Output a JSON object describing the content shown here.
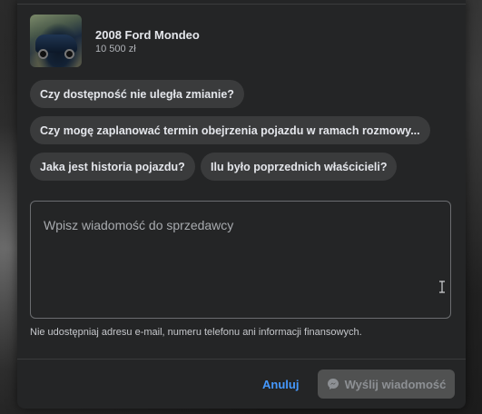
{
  "listing": {
    "title": "2008 Ford Mondeo",
    "price": "10 500 zł"
  },
  "suggestions": [
    "Czy dostępność nie uległa zmianie?",
    "Czy mogę zaplanować termin obejrzenia pojazdu w ramach rozmowy...",
    "Jaka jest historia pojazdu?",
    "Ilu było poprzednich właścicieli?"
  ],
  "message": {
    "placeholder": "Wpisz wiadomość do sprzedawcy",
    "value": ""
  },
  "disclaimer": "Nie udostępniaj adresu e-mail, numeru telefonu ani informacji finansowych.",
  "actions": {
    "cancel_label": "Anuluj",
    "send_label": "Wyślij wiadomość"
  },
  "icons": {
    "send": "messenger-icon",
    "cursor": "text-cursor-icon"
  },
  "colors": {
    "accent": "#4599ff",
    "surface": "#242526",
    "chip": "#3a3b3c",
    "disabled_button": "#505151"
  }
}
